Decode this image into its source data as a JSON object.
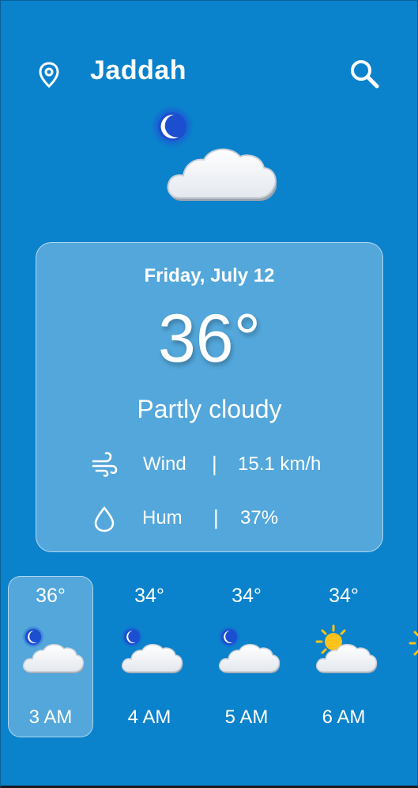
{
  "header": {
    "city": "Jaddah",
    "location_icon": "map-pin-icon",
    "search_icon": "search-icon"
  },
  "current": {
    "icon": "moon-cloud-icon",
    "date": "Friday, July 12",
    "temperature": "36°",
    "condition": "Partly cloudy",
    "wind": {
      "icon": "wind-icon",
      "label": "Wind",
      "separator": "|",
      "value": "15.1 km/h"
    },
    "humidity": {
      "icon": "droplet-icon",
      "label": "Hum",
      "separator": "|",
      "value": "37%"
    }
  },
  "hourly": [
    {
      "temp": "36°",
      "time": "3 AM",
      "icon": "moon-cloud-icon",
      "selected": true
    },
    {
      "temp": "34°",
      "time": "4 AM",
      "icon": "moon-cloud-icon",
      "selected": false
    },
    {
      "temp": "34°",
      "time": "5 AM",
      "icon": "moon-cloud-icon",
      "selected": false
    },
    {
      "temp": "34°",
      "time": "6 AM",
      "icon": "sun-cloud-icon",
      "selected": false
    }
  ],
  "colors": {
    "background": "#0a82cc",
    "moon": "#1e56d6",
    "sun": "#ffc21a"
  }
}
